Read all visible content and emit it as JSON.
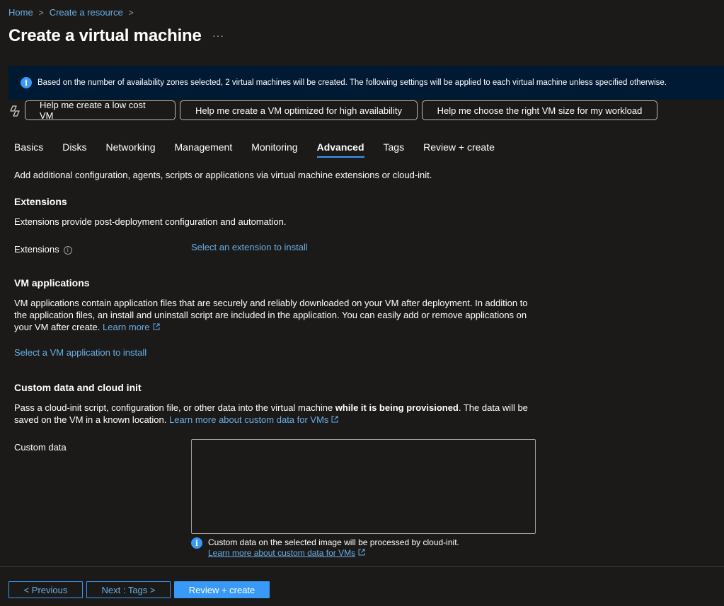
{
  "breadcrumb": {
    "home": "Home",
    "create": "Create a resource",
    "separator": ">"
  },
  "page": {
    "title": "Create a virtual machine",
    "more": "···"
  },
  "banner": {
    "text": "Based on the number of availability zones selected, 2 virtual machines will be created. The following settings will be applied to each virtual machine unless specified otherwise."
  },
  "copilot": {
    "buttons": [
      "Help me create a low cost VM",
      "Help me create a VM optimized for high availability",
      "Help me choose the right VM size for my workload"
    ]
  },
  "tabs": [
    "Basics",
    "Disks",
    "Networking",
    "Management",
    "Monitoring",
    "Advanced",
    "Tags",
    "Review + create"
  ],
  "active_tab": "Advanced",
  "intro": "Add additional configuration, agents, scripts or applications via virtual machine extensions or cloud-init.",
  "extensions": {
    "heading": "Extensions",
    "desc": "Extensions provide post-deployment configuration and automation.",
    "label": "Extensions",
    "link": "Select an extension to install"
  },
  "vm_apps": {
    "heading": "VM applications",
    "desc_line1": "VM applications contain application files that are securely and reliably downloaded on your VM after deployment. In addition to",
    "desc_line2": "the application files, an install and uninstall script are included in the application. You can easily add or remove applications on",
    "desc_line3": "your VM after create.",
    "learn_more": "Learn more",
    "link": "Select a VM application to install"
  },
  "custom_data": {
    "heading": "Custom data and cloud init",
    "desc_pre": "Pass a cloud-init script, configuration file, or other data into the virtual machine ",
    "desc_bold": "while it is being provisioned",
    "desc_post": ". The data will be",
    "desc_line2": "saved on the VM in a known location.",
    "learn_more": "Learn more about custom data for VMs",
    "label": "Custom data",
    "value": "",
    "note": "Custom data on the selected image will be processed by cloud-init.",
    "note_link": "Learn more about custom data for VMs"
  },
  "footer": {
    "previous": "< Previous",
    "next": "Next : Tags >",
    "review": "Review + create"
  },
  "colors": {
    "accent": "#3899f7",
    "link": "#69afe5",
    "background": "#1b1a19",
    "banner": "#001a33"
  }
}
